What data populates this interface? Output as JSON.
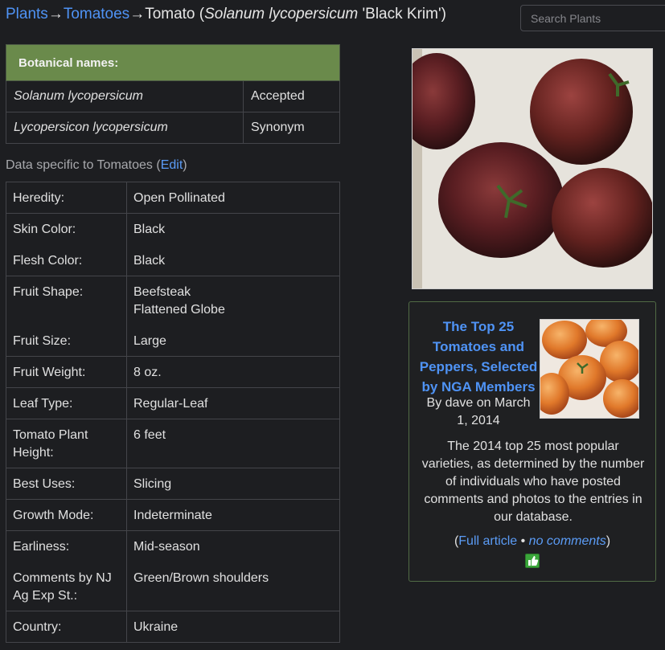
{
  "breadcrumb": {
    "plants": "Plants",
    "arrow": "→",
    "tomatoes": "Tomatoes",
    "current_prefix": "Tomato (",
    "current_species": "Solanum lycopersicum",
    "current_suffix": " 'Black Krim')"
  },
  "search": {
    "placeholder": "Search Plants"
  },
  "botanical": {
    "header": "Botanical names:",
    "rows": [
      {
        "name": "Solanum lycopersicum",
        "status": "Accepted"
      },
      {
        "name": "Lycopersicon lycopersicum",
        "status": "Synonym"
      }
    ]
  },
  "data_caption": {
    "prefix": "Data specific to Tomatoes (",
    "edit": "Edit",
    "suffix": ")"
  },
  "data": {
    "heredity": {
      "k": "Heredity:",
      "v": "Open Pollinated"
    },
    "skin": {
      "k": "Skin Color:",
      "v": "Black"
    },
    "flesh": {
      "k": "Flesh Color:",
      "v": "Black"
    },
    "shape": {
      "k": "Fruit Shape:",
      "v1": "Beefsteak",
      "v2": "Flattened Globe"
    },
    "size": {
      "k": "Fruit Size:",
      "v": "Large"
    },
    "weight": {
      "k": "Fruit Weight:",
      "v": "8 oz."
    },
    "leaf": {
      "k": "Leaf Type:",
      "v": "Regular-Leaf"
    },
    "height": {
      "k1": "Tomato Plant",
      "k2": "Height:",
      "v": "6 feet"
    },
    "uses": {
      "k": "Best Uses:",
      "v": "Slicing"
    },
    "growth": {
      "k": "Growth Mode:",
      "v": "Indeterminate"
    },
    "earliness": {
      "k": "Earliness:",
      "v": "Mid-season"
    },
    "comments": {
      "k1": "Comments by NJ",
      "k2": "Ag Exp St.:",
      "v": "Green/Brown shoulders"
    },
    "country": {
      "k": "Country:",
      "v": "Ukraine"
    }
  },
  "article": {
    "title_lines": [
      "The Top 25",
      "Tomatoes and",
      "Peppers, Selected",
      "by NGA Members"
    ],
    "byline_lines": [
      "By dave on March",
      "1, 2014"
    ],
    "summary_lines": [
      "The 2014 top 25 most popular",
      "varieties, as determined by the number",
      "of individuals who have posted",
      "comments and photos to the entries in",
      "our database."
    ],
    "links": {
      "open": "(",
      "full": "Full article",
      "sep": " • ",
      "comments": "no comments",
      "close": ")"
    }
  },
  "colors": {
    "background": "#1d1e21",
    "header_green": "#6a8a4b",
    "link_blue": "#4f93f5",
    "border": "#44454a"
  },
  "icons": {
    "thumbs_up": "thumbs-up-icon"
  }
}
